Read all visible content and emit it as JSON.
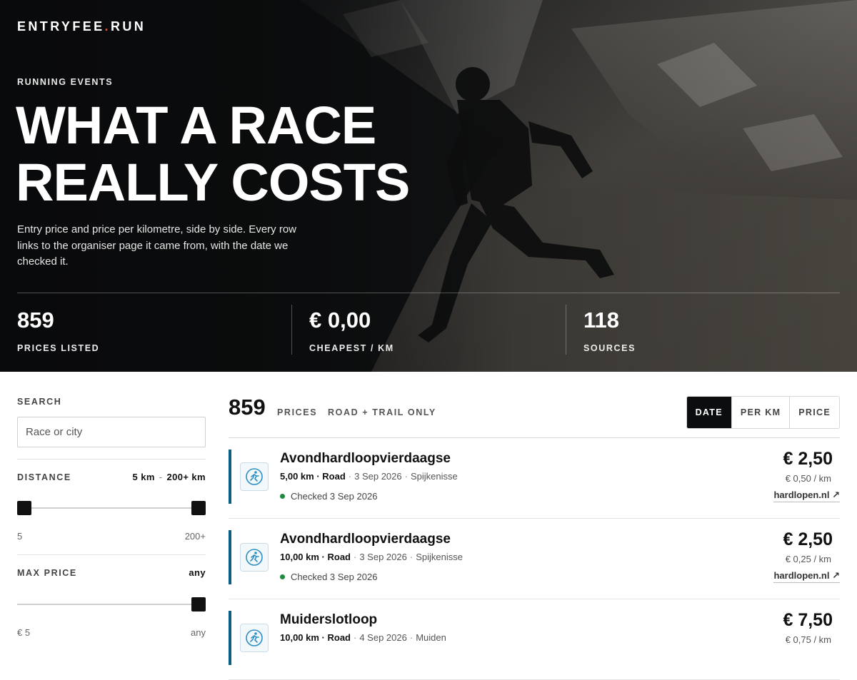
{
  "brand": {
    "name": "ENTRYFEE",
    "dot": ".",
    "suffix": "RUN"
  },
  "hero": {
    "kicker": "RUNNING EVENTS",
    "headline_line1": "WHAT A RACE",
    "headline_line2": "REALLY COSTS",
    "intro": "Entry price and price per kilometre, side by side. Every row links to the organiser page it came from, with the date we checked it.",
    "stats": [
      {
        "value": "859",
        "label": "PRICES LISTED"
      },
      {
        "value": "€ 0,00",
        "label": "CHEAPEST / KM"
      },
      {
        "value": "118",
        "label": "SOURCES"
      }
    ]
  },
  "sidebar": {
    "search_label": "SEARCH",
    "search_placeholder": "Race or city",
    "distance": {
      "label": "DISTANCE",
      "from": "5 km",
      "sep": "-",
      "to": "200+ km",
      "tick_min": "5",
      "tick_max": "200+",
      "low": 0,
      "high": 1
    },
    "max_price": {
      "label": "MAX PRICE",
      "value": "any",
      "tick_min": "€ 5",
      "tick_max": "any",
      "level": 1
    }
  },
  "list": {
    "count": "859",
    "count_label": "PRICES",
    "filter_label": "ROAD + TRAIL ONLY",
    "sort": [
      "DATE",
      "PER KM",
      "PRICE"
    ],
    "sort_active": "DATE",
    "items": [
      {
        "title": "Avondhardloopvierdaagse",
        "distance": "5,00 km",
        "type": "Road",
        "date": "3 Sep 2026",
        "city": "Spijkenisse",
        "checked": "Checked 3 Sep 2026",
        "price": "€ 2,50",
        "per_km": "€ 0,50 / km",
        "source": "hardlopen.nl ↗"
      },
      {
        "title": "Avondhardloopvierdaagse",
        "distance": "10,00 km",
        "type": "Road",
        "date": "3 Sep 2026",
        "city": "Spijkenisse",
        "checked": "Checked 3 Sep 2026",
        "price": "€ 2,50",
        "per_km": "€ 0,25 / km",
        "source": "hardlopen.nl ↗"
      },
      {
        "title": "Muiderslotloop",
        "distance": "10,00 km",
        "type": "Road",
        "date": "4 Sep 2026",
        "city": "Muiden",
        "checked": "",
        "price": "€ 7,50",
        "per_km": "€ 0,75 / km",
        "source": ""
      }
    ]
  },
  "colors": {
    "accent": "#e4502c",
    "bar": "#0b5f86",
    "check": "#1e8a3c"
  },
  "icons": {
    "runner_logo": "runner-icon",
    "external": "external-link-icon"
  }
}
